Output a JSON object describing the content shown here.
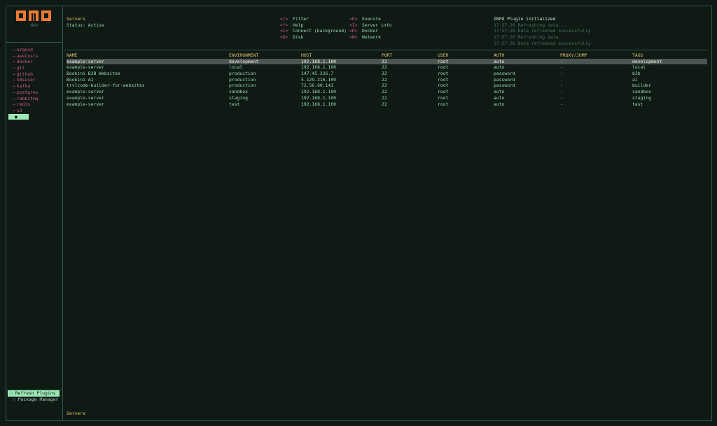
{
  "app": {
    "logo": "OMO",
    "subtitle": "dev"
  },
  "sidebar": {
    "items": [
      {
        "label": "argocd"
      },
      {
        "label": "awsCosts"
      },
      {
        "label": "docker"
      },
      {
        "label": "git"
      },
      {
        "label": "github"
      },
      {
        "label": "k8suser"
      },
      {
        "label": "kafka"
      },
      {
        "label": "postgres"
      },
      {
        "label": "rabbitmq"
      },
      {
        "label": "redis"
      },
      {
        "label": "s3"
      }
    ],
    "arrow": "→",
    "selected_marker": "●",
    "bottom": {
      "refresh": "◌ Refresh Plugins",
      "manager": "◌ Package Manager"
    }
  },
  "header": {
    "title": "Servers",
    "status": "Status: Active",
    "keys_left": [
      {
        "key": "</>",
        "label": "Filter"
      },
      {
        "key": "<?>",
        "label": "Help"
      },
      {
        "key": "<C>",
        "label": "Connect (background)"
      },
      {
        "key": "<D>",
        "label": "Disk"
      }
    ],
    "keys_right": [
      {
        "key": "<E>",
        "label": "Execute"
      },
      {
        "key": "<I>",
        "label": "Server info"
      },
      {
        "key": "<K>",
        "label": "Docker"
      },
      {
        "key": "<N>",
        "label": "Network"
      }
    ],
    "logs": [
      "INFO Plugin initialized",
      "17:57:26 Refreshing data...",
      "17:57:26 Data refreshed successfully",
      "17:57:26 Refreshing data...",
      "17:57:26 Data refreshed successfully"
    ]
  },
  "table": {
    "columns": [
      "NAME",
      "ENVIRONMENT",
      "HOST",
      "PORT",
      "USER",
      "AUTH",
      "PROXY/JUMP",
      "TAGS"
    ],
    "rows": [
      [
        "example-server",
        "development",
        "192.168.1.100",
        "22",
        "root",
        "auto",
        "-",
        "development"
      ],
      [
        "example-server",
        "local",
        "192.168.1.100",
        "22",
        "root",
        "auto",
        "-",
        "local"
      ],
      [
        " Bookini B2B Websites",
        "production",
        "147.45.226.7",
        "22",
        "root",
        "password",
        "-",
        "b2b"
      ],
      [
        "Bookini AI",
        "production",
        "5.129.216.109",
        "22",
        "root",
        "password",
        "-",
        "ai"
      ],
      [
        "trvlcode-builder-for-websites",
        "production",
        "72.56.60.141",
        "22",
        "root",
        "password",
        "-",
        "builder"
      ],
      [
        "example-server",
        "sandbox",
        "192.168.1.100",
        "22",
        "root",
        "auto",
        "-",
        "sandbox"
      ],
      [
        "example-server",
        "staging",
        "192.168.1.100",
        "22",
        "root",
        "auto",
        "-",
        "staging"
      ],
      [
        "example-server",
        "test",
        "192.168.1.100",
        "22",
        "root",
        "auto",
        "-",
        "test"
      ]
    ]
  },
  "footer": {
    "label": "Servers"
  },
  "colors": {
    "background": "#0f1a15",
    "border": "#2f5a48",
    "accent": "#e3c56d",
    "plugin": "#d4568a",
    "text": "#9ad8b8",
    "selection": "#9ee8b8",
    "logo": "#f07a33"
  }
}
